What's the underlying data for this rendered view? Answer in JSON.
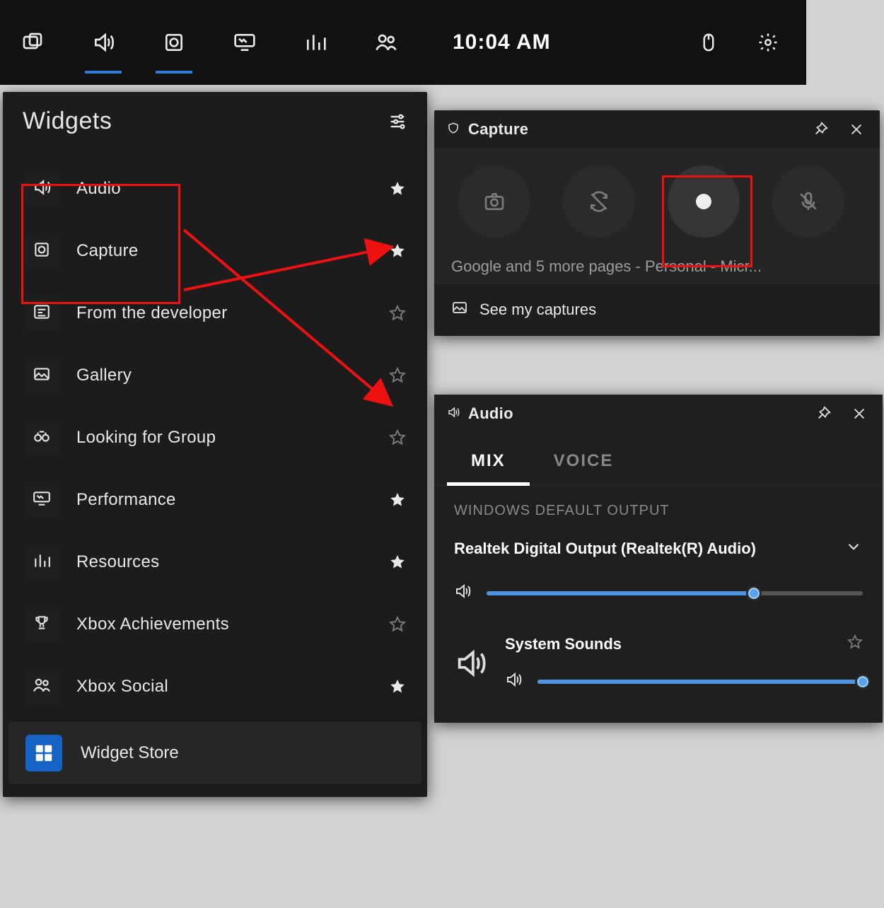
{
  "topbar": {
    "clock": "10:04 AM"
  },
  "widgets": {
    "title": "Widgets",
    "items": [
      {
        "label": "Audio",
        "starred": true
      },
      {
        "label": "Capture",
        "starred": true
      },
      {
        "label": "From the developer",
        "starred": false
      },
      {
        "label": "Gallery",
        "starred": false
      },
      {
        "label": "Looking for Group",
        "starred": false
      },
      {
        "label": "Performance",
        "starred": true
      },
      {
        "label": "Resources",
        "starred": true
      },
      {
        "label": "Xbox Achievements",
        "starred": false
      },
      {
        "label": "Xbox Social",
        "starred": true
      }
    ],
    "store": "Widget Store"
  },
  "capture": {
    "title": "Capture",
    "caption": "Google and 5 more pages - Personal - Micr...",
    "see": "See my captures"
  },
  "audio": {
    "title": "Audio",
    "tabs": {
      "mix": "MIX",
      "voice": "VOICE"
    },
    "section": "WINDOWS DEFAULT OUTPUT",
    "device": "Realtek Digital Output (Realtek(R) Audio)",
    "device_volume_pct": 71,
    "apps": [
      {
        "name": "System Sounds",
        "volume_pct": 100,
        "starred": false
      }
    ]
  }
}
